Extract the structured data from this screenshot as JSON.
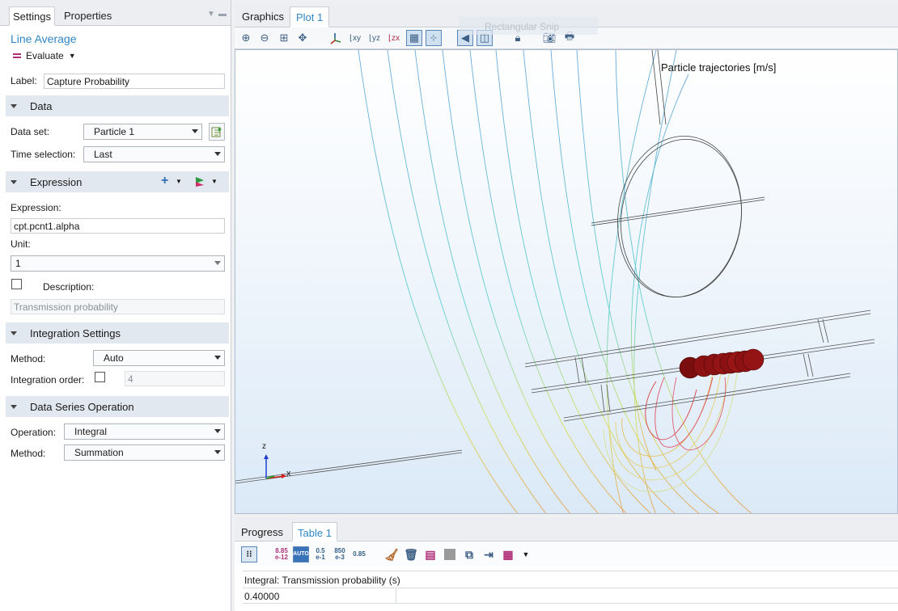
{
  "settings_panel": {
    "tabs": [
      "Settings",
      "Properties"
    ],
    "node_title": "Line Average",
    "evaluate_label": "Evaluate",
    "label_field": {
      "label": "Label:",
      "value": "Capture Probability"
    },
    "data_section": {
      "title": "Data",
      "data_set": {
        "label": "Data set:",
        "value": "Particle 1"
      },
      "time_selection": {
        "label": "Time selection:",
        "value": "Last"
      }
    },
    "expression_section": {
      "title": "Expression",
      "expression_label": "Expression:",
      "expression_value": "cpt.pcnt1.alpha",
      "unit_label": "Unit:",
      "unit_value": "1",
      "description_label": "Description:",
      "description_value": "Transmission probability",
      "description_checked": false
    },
    "integration_section": {
      "title": "Integration Settings",
      "method": {
        "label": "Method:",
        "value": "Auto"
      },
      "order": {
        "label": "Integration order:",
        "value": "4",
        "checked": false
      }
    },
    "data_series_section": {
      "title": "Data Series Operation",
      "operation": {
        "label": "Operation:",
        "value": "Integral"
      },
      "method": {
        "label": "Method:",
        "value": "Summation"
      }
    }
  },
  "graphics": {
    "tabs": [
      "Graphics",
      "Plot 1"
    ],
    "active_tab": "Plot 1",
    "overlay_text": "Rectangular Snip",
    "plot_title": "Particle trajectories [m/s]",
    "axes": {
      "z": "z",
      "x": "x"
    },
    "toolbar_icons": [
      "zoom-in-icon",
      "zoom-out-icon",
      "zoom-box-icon",
      "zoom-extents-icon",
      "default-view-icon",
      "xy-view-icon",
      "yz-view-icon",
      "zx-view-icon",
      "grid-icon",
      "axis-orientation-icon",
      "scene-light-icon",
      "transparency-icon",
      "lock-icon",
      "camera-icon",
      "print-icon"
    ]
  },
  "results": {
    "tabs": [
      "Progress",
      "Table 1"
    ],
    "active_tab": "Table 1",
    "format_buttons": [
      "8.85\ne-12",
      "AUTO",
      "0.5\ne-1",
      "850\ne-3",
      "0.85"
    ],
    "table": {
      "header": "Integral: Transmission probability (s)",
      "rows": [
        [
          "0.40000"
        ]
      ]
    }
  },
  "colors": {
    "accent": "#2f86c5",
    "section_bg": "#e2e8ef",
    "particle": "#8b0f10",
    "evaluate_icon": "#b1307a"
  }
}
